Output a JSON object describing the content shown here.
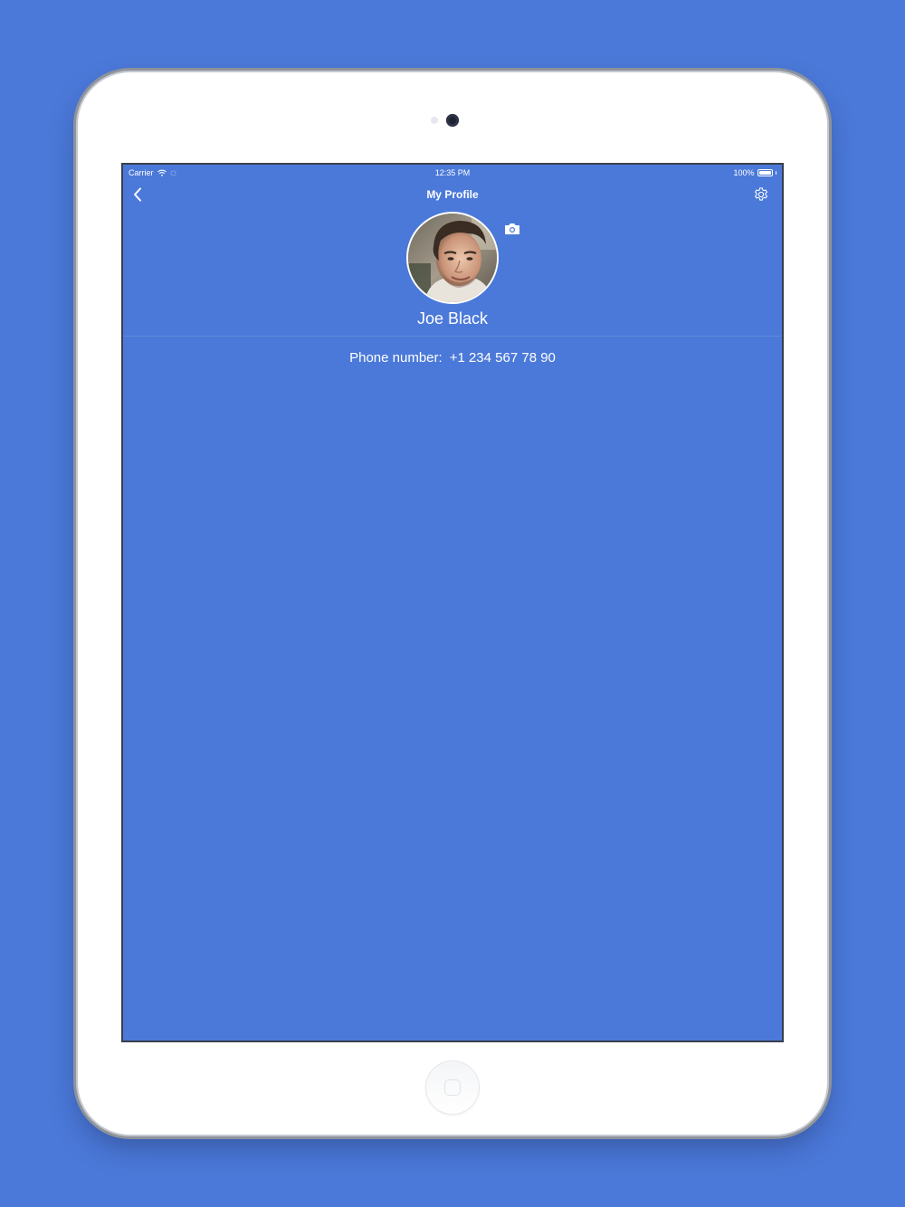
{
  "status_bar": {
    "carrier": "Carrier",
    "time": "12:35 PM",
    "battery_percent": "100%",
    "battery_level": 1.0
  },
  "nav": {
    "back_icon": "chevron-left-icon",
    "title": "My Profile",
    "settings_icon": "gear-icon"
  },
  "profile": {
    "avatar_icon": "user-photo",
    "camera_icon": "camera-icon",
    "name": "Joe Black",
    "phone_label": "Phone number:",
    "phone_value": "+1 234 567 78 90"
  },
  "colors": {
    "background": "#4b79d9",
    "text": "#ffffff",
    "device_frame": "#ffffff"
  }
}
